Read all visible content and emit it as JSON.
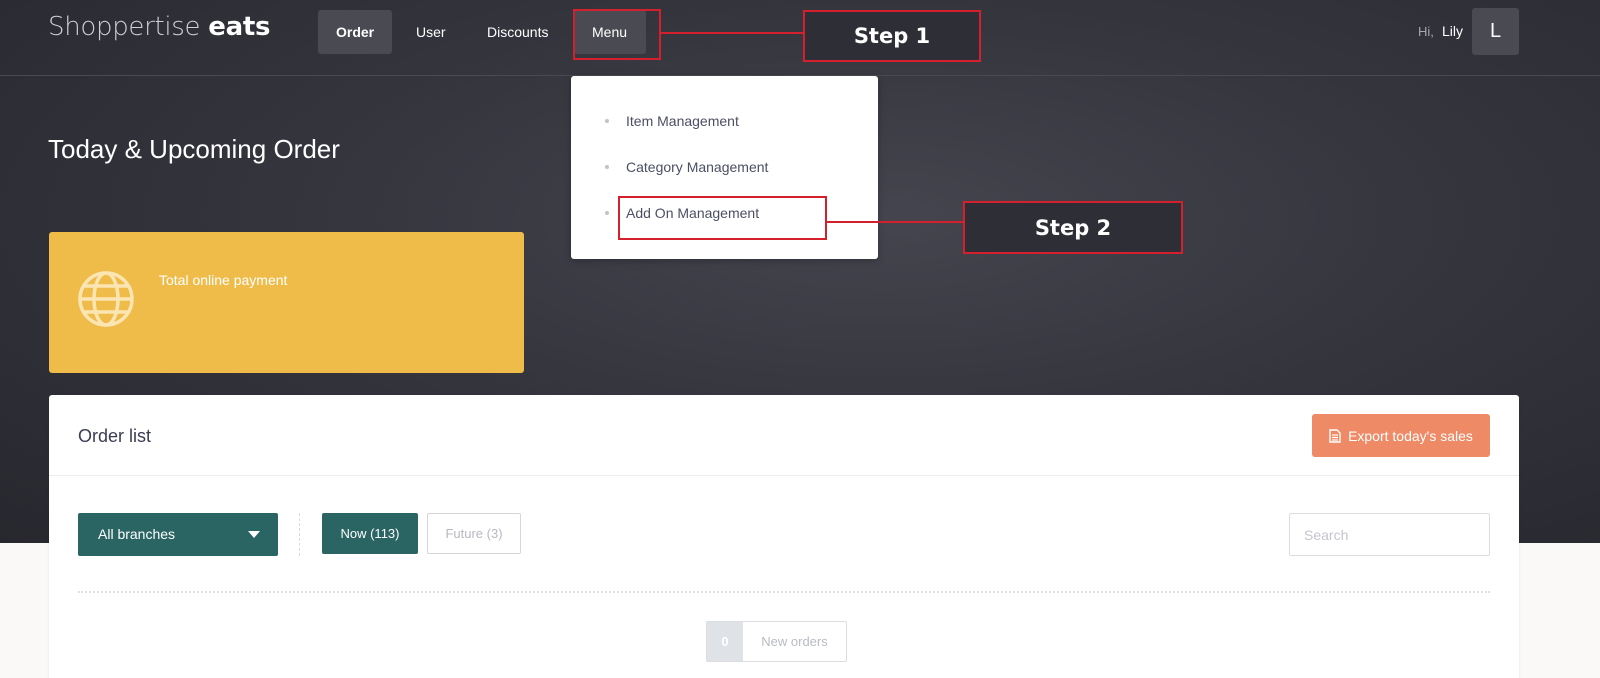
{
  "brand": {
    "name_light": "Shoppertise",
    "name_bold": "eats"
  },
  "nav": {
    "items": [
      {
        "label": "Order",
        "active": true
      },
      {
        "label": "User"
      },
      {
        "label": "Discounts"
      },
      {
        "label": "Menu"
      }
    ],
    "greeting": "Hi,",
    "user_name": "Lily",
    "avatar_initial": "L"
  },
  "menu_dropdown": {
    "items": [
      {
        "label": "Item Management"
      },
      {
        "label": "Category Management"
      },
      {
        "label": "Add On Management"
      }
    ]
  },
  "annotations": {
    "step1": "Step 1",
    "step2": "Step 2"
  },
  "page_title": "Today & Upcoming Order",
  "stat_card": {
    "label": "Total online payment",
    "icon": "globe-icon",
    "color": "#efbc4a"
  },
  "order_list": {
    "title": "Order list",
    "export_label": "Export today's sales",
    "export_icon": "document-icon",
    "branch_select": "All branches",
    "tabs": [
      {
        "label": "Now (113)",
        "active": true
      },
      {
        "label": "Future (3)"
      }
    ],
    "search_placeholder": "Search",
    "new_orders": {
      "count": "0",
      "label": "New orders"
    }
  },
  "colors": {
    "accent_teal": "#2b6563",
    "export_orange": "#ee8a66",
    "annotation_red": "#d4202c"
  }
}
